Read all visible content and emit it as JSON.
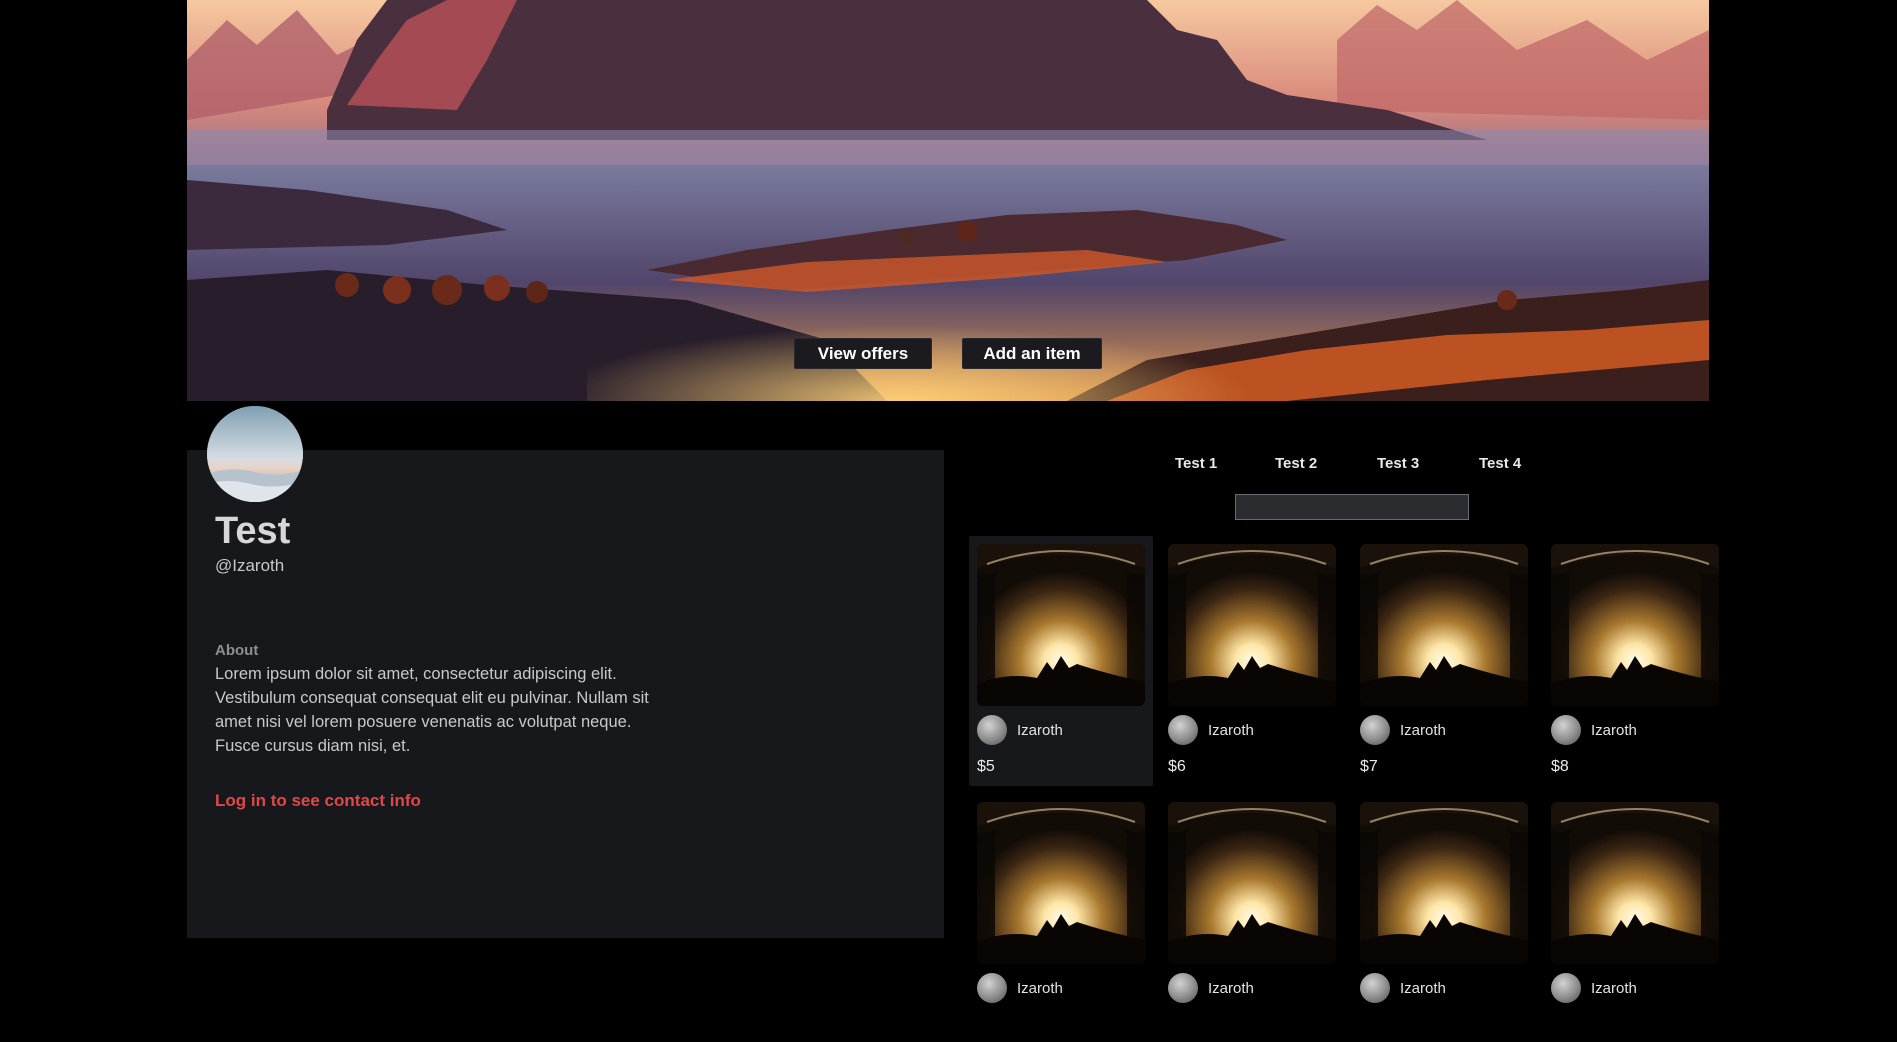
{
  "banner": {
    "view_offers_label": "View offers",
    "add_item_label": "Add an item"
  },
  "profile": {
    "name": "Test",
    "handle": "@Izaroth",
    "about_heading": "About",
    "about_text": "Lorem ipsum dolor sit amet, consectetur adipiscing elit. Vestibulum consequat consequat elit eu pulvinar. Nullam sit amet nisi vel lorem posuere venenatis ac volutpat neque. Fusce cursus diam nisi, et.",
    "contact_link": "Log in to see contact info"
  },
  "tabs": [
    {
      "label": "Test 1"
    },
    {
      "label": "Test 2"
    },
    {
      "label": "Test 3"
    },
    {
      "label": "Test 4"
    }
  ],
  "search": {
    "value": "",
    "placeholder": ""
  },
  "items": [
    {
      "seller": "Izaroth",
      "price": "$5"
    },
    {
      "seller": "Izaroth",
      "price": "$6"
    },
    {
      "seller": "Izaroth",
      "price": "$7"
    },
    {
      "seller": "Izaroth",
      "price": "$8"
    },
    {
      "seller": "Izaroth",
      "price": ""
    },
    {
      "seller": "Izaroth",
      "price": ""
    },
    {
      "seller": "Izaroth",
      "price": ""
    },
    {
      "seller": "Izaroth",
      "price": ""
    }
  ],
  "colors": {
    "page_background": "#000000",
    "panel_background": "#17181b",
    "accent_link": "#e04848",
    "button_background": "#1b1b1f"
  },
  "icons": {
    "profile_avatar": "avatar-image",
    "seller_avatar": "seller-avatar-image"
  }
}
